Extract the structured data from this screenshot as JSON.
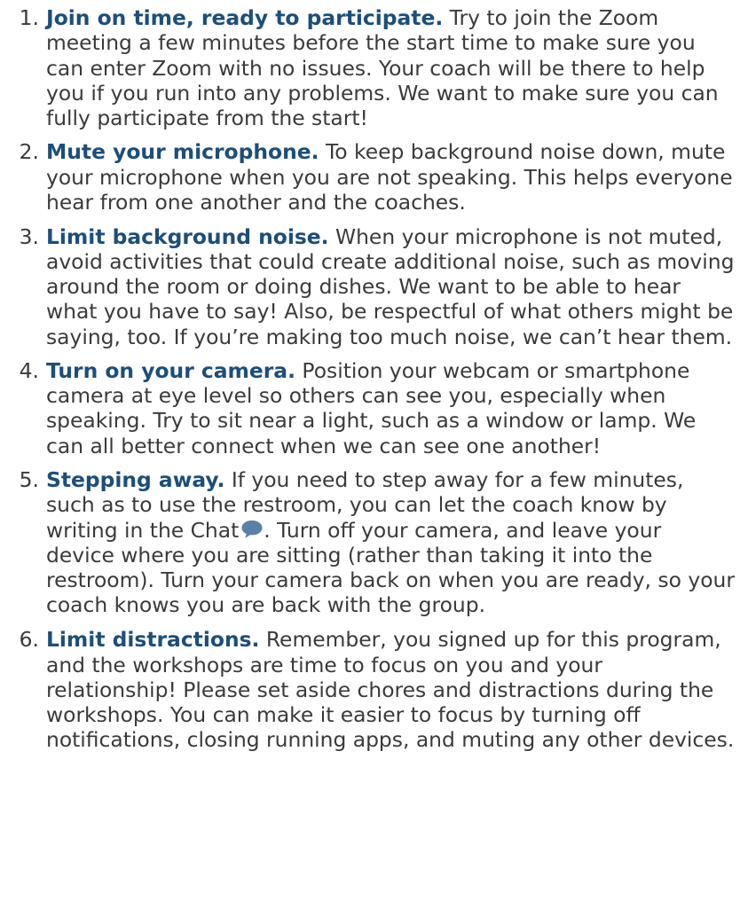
{
  "guidelines": [
    {
      "number": "1.",
      "title": "Join on time, ready to participate.",
      "body": "Try to join the Zoom meeting a few minutes before the start time to make sure you can enter Zoom with no issues. Your coach will be there to help you if you run into any problems. We want to make sure you can fully participate from the start!"
    },
    {
      "number": "2.",
      "title": "Mute your microphone.",
      "body": "To keep background noise down, mute your microphone when you are not speaking. This helps everyone hear from one another and the coaches."
    },
    {
      "number": "3.",
      "title": "Limit background noise.",
      "body": "When your microphone is not muted, avoid activities that could create additional noise, such as moving around the room or doing dishes. We want to be able to hear what you have to say! Also, be respectful of what others might be saying, too. If you’re making too much noise, we can’t hear them."
    },
    {
      "number": "4.",
      "title": "Turn on your camera.",
      "body": "Position your webcam or smartphone camera at eye level so others can see you, especially when speaking. Try to sit near a light, such as a window or lamp. We can all better connect when we can see one another!"
    },
    {
      "number": "5.",
      "title": "Stepping away.",
      "body_before_icon": "If you need to step away for a few minutes, such as to use the restroom, you can let the coach know by writing in the Chat",
      "icon": "chat-bubble-icon",
      "body_after_icon": ". Turn off your camera, and leave your device where you are sitting (rather than taking it into the restroom). Turn your camera back on when you are ready, so your coach knows you are back with the group."
    },
    {
      "number": "6.",
      "title": "Limit distractions.",
      "body": "Remember, you signed up for this program, and the workshops are time to focus on you and your relationship! Please set aside chores and distractions during the workshops. You can make it easier to focus by turning off notifications, closing running apps, and muting any other devices."
    }
  ],
  "colors": {
    "title": "#1d4e79",
    "body": "#3a3a3a",
    "icon": "#5b7fa6"
  }
}
